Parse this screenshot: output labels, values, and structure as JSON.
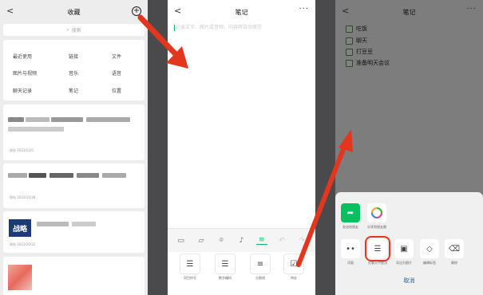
{
  "panel1": {
    "title": "收藏",
    "search_placeholder": "搜索",
    "categories": [
      "最近使用",
      "链接",
      "文件",
      "图片与视频",
      "音乐",
      "语音",
      "聊天记录",
      "笔记",
      "位置"
    ],
    "cards": [
      {
        "date": "2023/12/5"
      },
      {
        "date": "2023/11/28"
      },
      {
        "date": "2023/10/31"
      }
    ],
    "badge_text": "战略"
  },
  "panel2": {
    "title": "笔记",
    "more": "···",
    "placeholder": "记录文字、图片或音频，内容将自动保存",
    "format_options": [
      {
        "label": "项目符号",
        "icon": "bullet-list-icon"
      },
      {
        "label": "数字编码",
        "icon": "numbered-list-icon"
      },
      {
        "label": "分割线",
        "icon": "divider-icon"
      },
      {
        "label": "待办",
        "icon": "todo-icon"
      }
    ]
  },
  "panel3": {
    "title": "笔记",
    "more": "···",
    "todos": [
      "吃饭",
      "聊天",
      "打豆豆",
      "准备明天会议"
    ],
    "share_actions": [
      {
        "label": "发送给朋友",
        "icon": "share-arrow-icon"
      },
      {
        "label": "分享到朋友圈",
        "icon": "moments-icon"
      }
    ],
    "tool_actions": [
      {
        "label": "浮窗",
        "icon": "float-window-icon"
      },
      {
        "label": "在聊天中置顶",
        "icon": "pin-to-chat-icon"
      },
      {
        "label": "导出为图片",
        "icon": "image-icon"
      },
      {
        "label": "编辑标签",
        "icon": "tag-icon"
      },
      {
        "label": "删除",
        "icon": "trash-icon"
      }
    ],
    "cancel": "取消"
  },
  "colors": {
    "accent": "#07c160",
    "arrow": "#e4361f",
    "highlight": "#e4361f"
  }
}
